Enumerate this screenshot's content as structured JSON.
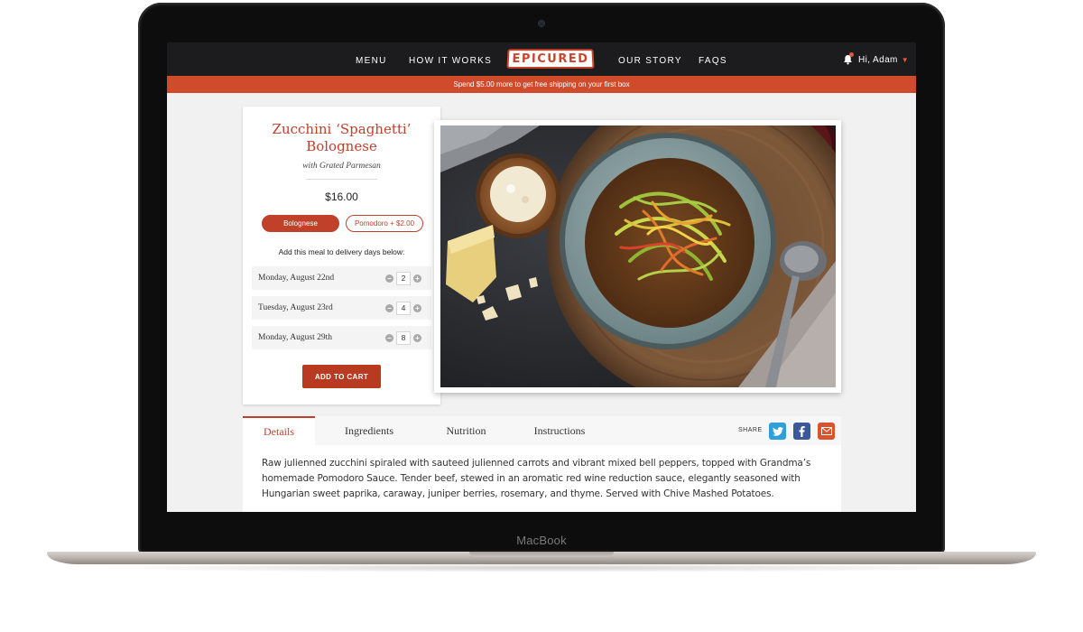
{
  "device": {
    "brand": "MacBook"
  },
  "nav": {
    "links": [
      "MENU",
      "HOW IT WORKS",
      "OUR STORY",
      "FAQS"
    ],
    "logo": "EPICURED",
    "greeting": "Hi, Adam"
  },
  "promo": "Spend $5.00 more to get free shipping on your first box",
  "product": {
    "title_line1": "Zucchini ‘Spaghetti’",
    "title_line2": "Bolognese",
    "subtitle": "with Grated Parmesan",
    "price": "$16.00",
    "options": [
      "Bolognese",
      "Pomodoro + $2.00"
    ],
    "selected_option": "Bolognese",
    "delivery_label": "Add this meal to delivery days below:",
    "days": [
      {
        "name": "Monday, August 22nd",
        "qty": "2"
      },
      {
        "name": "Tuesday, August 23rd",
        "qty": "4"
      },
      {
        "name": "Monday, August 29th",
        "qty": "8"
      }
    ],
    "add_to_cart": "ADD TO CART"
  },
  "tabs": [
    "Details",
    "Ingredients",
    "Nutrition",
    "Instructions"
  ],
  "active_tab": "Details",
  "share": {
    "label": "SHARE",
    "icons": [
      "twitter-icon",
      "facebook-icon",
      "email-icon"
    ]
  },
  "details": "Raw julienned zucchini spiraled with sauteed julienned carrots and vibrant mixed bell peppers, topped with Grandma’s homemade Pomodoro Sauce. Tender beef, stewed in an aromatic red wine reduction sauce, elegantly seasoned with Hungarian sweet paprika, caraway, juniper berries, rosemary, and thyme. Served with Chive Mashed Potatoes.",
  "colors": {
    "accent": "#c0402a",
    "promo_bar": "#d04b2c",
    "nav_bar": "#1c1c1e",
    "twitter": "#2d9fd9",
    "facebook": "#3b5998",
    "email": "#d9532c"
  }
}
